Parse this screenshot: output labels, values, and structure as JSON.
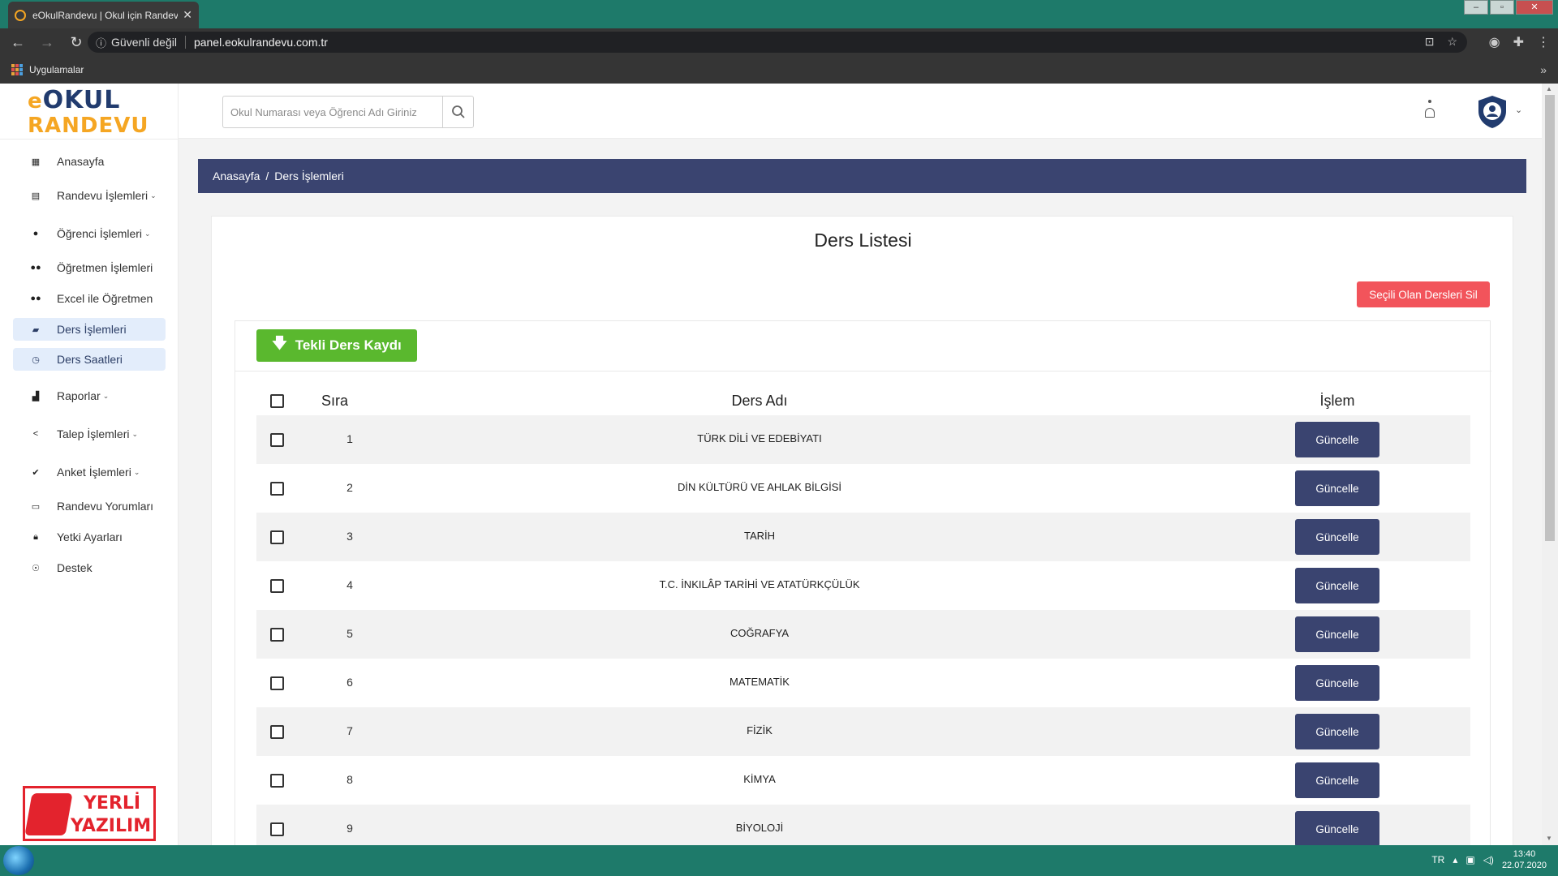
{
  "browser": {
    "tab_title": "eOkulRandevu | Okul için Randevu",
    "security_label": "Güvenli değil",
    "url": "panel.eokulrandevu.com.tr",
    "bookmarks_label": "Uygulamalar"
  },
  "logo": {
    "line1_e": "e",
    "line1": "OKUL",
    "line2": "RANDEVU"
  },
  "search": {
    "placeholder": "Okul Numarası veya Öğrenci Adı Giriniz"
  },
  "sidebar": {
    "items": [
      {
        "label": "Anasayfa",
        "icon": "dashboard-icon",
        "dropdown": false,
        "active": false
      },
      {
        "label": "Randevu İşlemleri",
        "icon": "calendar-icon",
        "dropdown": true,
        "active": false
      },
      {
        "label": "Öğrenci İşlemleri",
        "icon": "user-icon",
        "dropdown": true,
        "active": false
      },
      {
        "label": "Öğretmen İşlemleri",
        "icon": "users-icon",
        "dropdown": false,
        "active": false
      },
      {
        "label": "Excel ile Öğretmen",
        "icon": "users-icon",
        "dropdown": false,
        "active": false
      },
      {
        "label": "Ders İşlemleri",
        "icon": "book-icon",
        "dropdown": false,
        "active": true
      },
      {
        "label": "Ders Saatleri",
        "icon": "clock-icon",
        "dropdown": false,
        "active": true
      },
      {
        "label": "Raporlar",
        "icon": "bar-chart-icon",
        "dropdown": true,
        "active": false
      },
      {
        "label": "Talep İşlemleri",
        "icon": "share-icon",
        "dropdown": true,
        "active": false
      },
      {
        "label": "Anket İşlemleri",
        "icon": "check-circle-icon",
        "dropdown": true,
        "active": false
      },
      {
        "label": "Randevu Yorumları",
        "icon": "comment-icon",
        "dropdown": false,
        "active": false
      },
      {
        "label": "Yetki Ayarları",
        "icon": "lock-icon",
        "dropdown": false,
        "active": false
      },
      {
        "label": "Destek",
        "icon": "support-icon",
        "dropdown": false,
        "active": false
      }
    ]
  },
  "yerli": {
    "line1": "YERLİ",
    "line2": "YAZILIM"
  },
  "breadcrumb": {
    "home": "Anasayfa",
    "separator": "/",
    "current": "Ders İşlemleri"
  },
  "card": {
    "title": "Ders Listesi",
    "delete_button": "Seçili Olan Dersleri Sil",
    "add_button": "Tekli Ders Kaydı"
  },
  "table": {
    "headers": {
      "order": "Sıra",
      "name": "Ders Adı",
      "action": "İşlem"
    },
    "rows": [
      {
        "order": "1",
        "name": "TÜRK DİLİ VE EDEBİYATI",
        "action": "Güncelle"
      },
      {
        "order": "2",
        "name": "DİN KÜLTÜRÜ VE AHLAK BİLGİSİ",
        "action": "Güncelle"
      },
      {
        "order": "3",
        "name": "TARİH",
        "action": "Güncelle"
      },
      {
        "order": "4",
        "name": "T.C. İNKILÂP TARİHİ VE ATATÜRKÇÜLÜK",
        "action": "Güncelle"
      },
      {
        "order": "5",
        "name": "COĞRAFYA",
        "action": "Güncelle"
      },
      {
        "order": "6",
        "name": "MATEMATİK",
        "action": "Güncelle"
      },
      {
        "order": "7",
        "name": "FİZİK",
        "action": "Güncelle"
      },
      {
        "order": "8",
        "name": "KİMYA",
        "action": "Güncelle"
      },
      {
        "order": "9",
        "name": "BİYOLOJİ",
        "action": "Güncelle"
      }
    ]
  },
  "taskbar": {
    "lang": "TR",
    "time": "13:40",
    "date": "22.07.2020"
  },
  "colors": {
    "primary": "#3a4470",
    "danger": "#f2545b",
    "success": "#5ab82e",
    "brand_orange": "#f5a623",
    "brand_navy": "#213b6e",
    "taskbar": "#1e7a6a"
  }
}
